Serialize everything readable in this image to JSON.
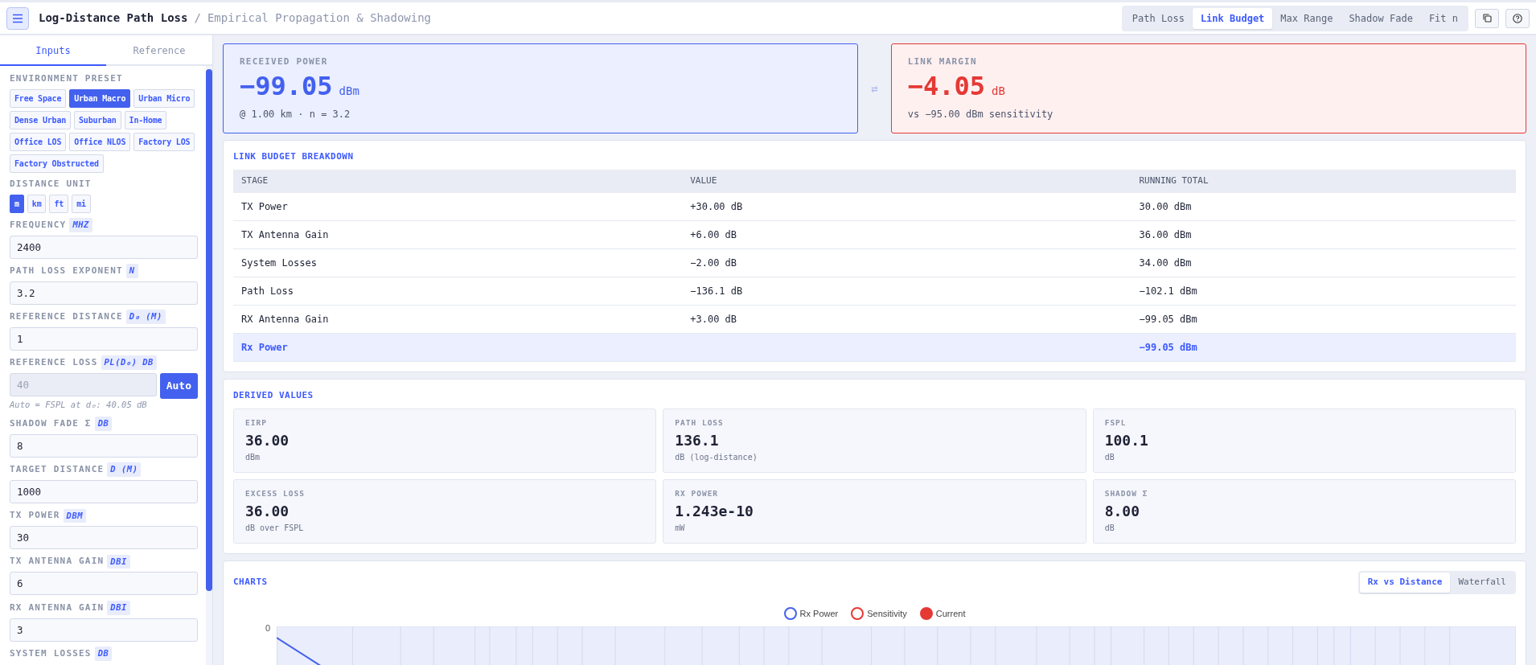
{
  "header": {
    "title": "Log-Distance Path Loss",
    "separator": "/",
    "subtitle": "Empirical Propagation & Shadowing",
    "tabs": [
      {
        "label": "Path Loss",
        "selected": false
      },
      {
        "label": "Link Budget",
        "selected": true
      },
      {
        "label": "Max Range",
        "selected": false
      },
      {
        "label": "Shadow Fade",
        "selected": false
      },
      {
        "label": "Fit n",
        "selected": false
      }
    ]
  },
  "sidebar": {
    "tabs": [
      {
        "label": "Inputs",
        "selected": true
      },
      {
        "label": "Reference",
        "selected": false
      }
    ],
    "preset_label": "ENVIRONMENT PRESET",
    "presets": [
      {
        "label": "Free Space",
        "selected": false
      },
      {
        "label": "Urban Macro",
        "selected": true
      },
      {
        "label": "Urban Micro",
        "selected": false
      },
      {
        "label": "Dense Urban",
        "selected": false
      },
      {
        "label": "Suburban",
        "selected": false
      },
      {
        "label": "In-Home",
        "selected": false
      },
      {
        "label": "Office LOS",
        "selected": false
      },
      {
        "label": "Office NLOS",
        "selected": false
      },
      {
        "label": "Factory LOS",
        "selected": false
      },
      {
        "label": "Factory Obstructed",
        "selected": false
      }
    ],
    "unit_label": "DISTANCE UNIT",
    "units": [
      {
        "label": "m",
        "selected": true
      },
      {
        "label": "km",
        "selected": false
      },
      {
        "label": "ft",
        "selected": false
      },
      {
        "label": "mi",
        "selected": false
      }
    ],
    "fields": [
      {
        "label": "FREQUENCY",
        "unit": "MHZ",
        "value": "2400",
        "disabled": false
      },
      {
        "label": "PATH LOSS EXPONENT",
        "unit": "N",
        "value": "3.2",
        "disabled": false
      },
      {
        "label": "REFERENCE DISTANCE",
        "unit": "D₀ (M)",
        "value": "1",
        "disabled": false
      },
      {
        "label": "REFERENCE LOSS",
        "unit": "PL(D₀) DB",
        "value": "40",
        "disabled": true,
        "button": "Auto",
        "hint": "Auto = FSPL at d₀: 40.05 dB"
      },
      {
        "label": "SHADOW FADE Σ",
        "unit": "DB",
        "value": "8",
        "disabled": false
      },
      {
        "label": "TARGET DISTANCE",
        "unit": "D (M)",
        "value": "1000",
        "disabled": false
      },
      {
        "label": "TX POWER",
        "unit": "DBM",
        "value": "30",
        "disabled": false
      },
      {
        "label": "TX ANTENNA GAIN",
        "unit": "DBI",
        "value": "6",
        "disabled": false
      },
      {
        "label": "RX ANTENNA GAIN",
        "unit": "DBI",
        "value": "3",
        "disabled": false
      },
      {
        "label": "SYSTEM LOSSES",
        "unit": "DB"
      }
    ]
  },
  "summary": [
    {
      "kind": "good",
      "label": "RECEIVED POWER",
      "value": "−99.05",
      "unit": "dBm",
      "note": "@ 1.00 km · n = 3.2"
    },
    {
      "kind": "bad",
      "label": "LINK MARGIN",
      "value": "−4.05",
      "unit": "dB",
      "note": "vs −95.00 dBm sensitivity"
    }
  ],
  "swap_icon": "⇄",
  "breakdown": {
    "title": "LINK BUDGET BREAKDOWN",
    "columns": [
      "STAGE",
      "VALUE",
      "RUNNING TOTAL"
    ],
    "rows": [
      {
        "cells": [
          "TX Power",
          "+30.00 dB",
          "30.00 dBm"
        ],
        "highlighted": false
      },
      {
        "cells": [
          "TX Antenna Gain",
          "+6.00 dB",
          "36.00 dBm"
        ],
        "highlighted": false
      },
      {
        "cells": [
          "System Losses",
          "−2.00 dB",
          "34.00 dBm"
        ],
        "highlighted": false
      },
      {
        "cells": [
          "Path Loss",
          "−136.1 dB",
          "−102.1 dBm"
        ],
        "highlighted": false
      },
      {
        "cells": [
          "RX Antenna Gain",
          "+3.00 dB",
          "−99.05 dBm"
        ],
        "highlighted": false
      },
      {
        "cells": [
          "Rx Power",
          "",
          "−99.05 dBm"
        ],
        "highlighted": true
      }
    ]
  },
  "derived": {
    "title": "DERIVED VALUES",
    "items": [
      {
        "label": "EIRP",
        "value": "36.00",
        "unit": "dBm"
      },
      {
        "label": "PATH LOSS",
        "value": "136.1",
        "unit": "dB (log-distance)"
      },
      {
        "label": "FSPL",
        "value": "100.1",
        "unit": "dB"
      },
      {
        "label": "EXCESS LOSS",
        "value": "36.00",
        "unit": "dB over FSPL"
      },
      {
        "label": "RX POWER",
        "value": "1.243e-10",
        "unit": "mW"
      },
      {
        "label": "SHADOW Σ",
        "value": "8.00",
        "unit": "dB"
      }
    ]
  },
  "charts": {
    "title": "CHARTS",
    "tabs": [
      {
        "label": "Rx vs Distance",
        "selected": true
      },
      {
        "label": "Waterfall",
        "selected": false
      }
    ],
    "legend": [
      {
        "label": "Rx Power",
        "color": "#4361ee",
        "filled": false
      },
      {
        "label": "Sensitivity",
        "color": "#e53935",
        "filled": false
      },
      {
        "label": "Current",
        "color": "#e53935",
        "filled": true
      }
    ],
    "y_tick": "0"
  }
}
